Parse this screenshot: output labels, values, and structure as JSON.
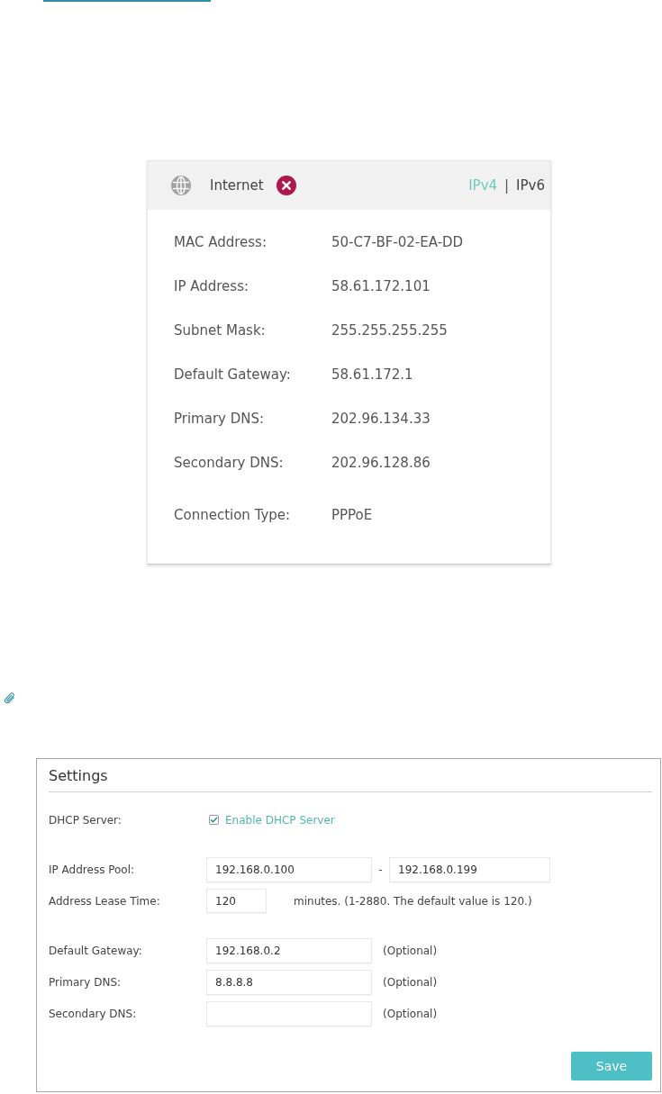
{
  "internet_panel": {
    "title": "Internet",
    "connected": false,
    "versions": [
      {
        "label": "IPv4",
        "selected": true
      },
      {
        "label": "IPv6",
        "selected": false
      }
    ],
    "separator": "|",
    "rows": [
      {
        "label": "MAC Address:",
        "value": "50-C7-BF-02-EA-DD"
      },
      {
        "label": "IP Address:",
        "value": "58.61.172.101"
      },
      {
        "label": "Subnet Mask:",
        "value": "255.255.255.255"
      },
      {
        "label": "Default Gateway:",
        "value": "58.61.172.1"
      },
      {
        "label": "Primary DNS:",
        "value": "202.96.134.33"
      },
      {
        "label": "Secondary DNS:",
        "value": "202.96.128.86"
      },
      {
        "label": "Connection Type:",
        "value": "PPPoE"
      }
    ]
  },
  "settings": {
    "title": "Settings",
    "sections": [
      {
        "rows": [
          {
            "kind": "checkbox",
            "label": "DHCP Server:",
            "option": "Enable DHCP Server",
            "checked": true
          }
        ]
      },
      {
        "rows": [
          {
            "kind": "range",
            "label": "IP Address Pool:",
            "start": "192.168.0.100",
            "separator": "-",
            "end": "192.168.0.199"
          },
          {
            "kind": "short",
            "label": "Address Lease Time:",
            "value": "120",
            "note": "minutes. (1-2880. The default value is 120.)"
          }
        ]
      },
      {
        "rows": [
          {
            "kind": "field",
            "label": "Default Gateway:",
            "value": "192.168.0.2",
            "note": "(Optional)"
          },
          {
            "kind": "field",
            "label": "Primary DNS:",
            "value": "8.8.8.8",
            "note": "(Optional)"
          },
          {
            "kind": "field",
            "label": "Secondary DNS:",
            "note": "(Optional)"
          }
        ]
      }
    ],
    "save_button": "Save"
  }
}
